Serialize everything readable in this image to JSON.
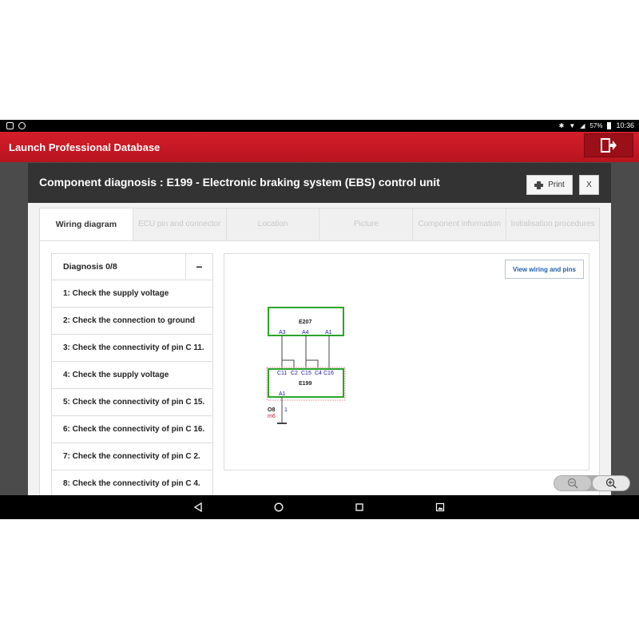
{
  "status_bar": {
    "battery": "57%",
    "time": "10:36",
    "icons": [
      "gallery-icon",
      "launch-icon",
      "bluetooth-icon",
      "wifi-icon",
      "signal-icon",
      "battery-icon"
    ]
  },
  "app_bar": {
    "title": "Launch Professional Database",
    "exit_icon": "exit-icon"
  },
  "modal": {
    "title": "Component diagnosis : E199 - Electronic braking system (EBS) control unit",
    "print_label": "Print",
    "close_label": "X"
  },
  "tabs": [
    {
      "label": "Wiring diagram",
      "active": true
    },
    {
      "label": "ECU pin and connector",
      "active": false
    },
    {
      "label": "Location",
      "active": false
    },
    {
      "label": "Picture",
      "active": false
    },
    {
      "label": "Component information",
      "active": false
    },
    {
      "label": "Initialisation procedures",
      "active": false
    }
  ],
  "diagnosis": {
    "header": "Diagnosis 0/8",
    "collapse_label": "−",
    "steps": [
      "1: Check the supply voltage",
      "2: Check the connection to ground",
      "3: Check the connectivity of pin C 11.",
      "4: Check the supply voltage",
      "5: Check the connectivity of pin C 15.",
      "6: Check the connectivity of pin C 16.",
      "7: Check the connectivity of pin C 2.",
      "8: Check the connectivity of pin C 4."
    ]
  },
  "diagram": {
    "view_button": "View wiring and pins",
    "top_component": {
      "name": "E207",
      "pins": [
        "A3",
        "A4",
        "A1"
      ]
    },
    "bottom_component": {
      "name": "E199",
      "pins": [
        "C11",
        "C2",
        "C15",
        "C4",
        "C16"
      ],
      "ground_pin": "A1"
    },
    "ground": {
      "label": "O8",
      "sub_label": "m6",
      "wire": "1"
    },
    "colors": {
      "box": "#2aa52a",
      "pin": "#1a1aa8",
      "ground_sub": "#c8102e"
    }
  },
  "zoom": {
    "out_icon": "zoom-out-icon",
    "in_icon": "zoom-in-icon"
  },
  "nav_bar": {
    "icons": [
      "back-icon",
      "home-icon",
      "recents-icon",
      "screenshot-icon"
    ]
  }
}
